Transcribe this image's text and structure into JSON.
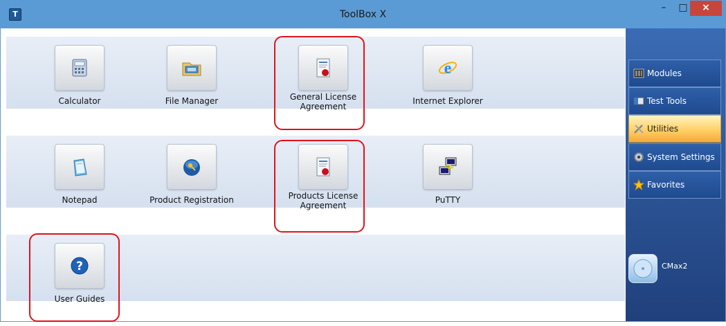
{
  "window": {
    "title": "ToolBox X",
    "app_icon": "T",
    "minimize": "–",
    "maximize": "□",
    "close": "×"
  },
  "tiles": [
    {
      "label": "Calculator",
      "icon": "calculator-icon"
    },
    {
      "label": "File Manager",
      "icon": "folder-icon"
    },
    {
      "label": "General License Agreement",
      "icon": "license-document-icon"
    },
    {
      "label": "Internet Explorer",
      "icon": "browser-icon"
    },
    {
      "label": "Notepad",
      "icon": "notepad-icon"
    },
    {
      "label": "Product Registration",
      "icon": "registration-key-icon"
    },
    {
      "label": "Products License Agreement",
      "icon": "license-document-icon"
    },
    {
      "label": "PuTTY",
      "icon": "putty-terminal-icon"
    },
    {
      "label": "User Guides",
      "icon": "help-icon"
    }
  ],
  "sidebar": {
    "items": [
      {
        "label": "Modules",
        "icon": "modules-icon"
      },
      {
        "label": "Test Tools",
        "icon": "test-tools-icon"
      },
      {
        "label": "Utilities",
        "icon": "utilities-icon",
        "active": true
      },
      {
        "label": "System Settings",
        "icon": "gear-icon"
      },
      {
        "label": "Favorites",
        "icon": "star-icon"
      }
    ],
    "module": {
      "label": "CMax2",
      "icon": "module-disc-icon"
    }
  },
  "colors": {
    "highlight": "#e0121b",
    "titlebar": "#5b9bd5",
    "active_nav": "#ffd067",
    "close": "#c7463b"
  }
}
